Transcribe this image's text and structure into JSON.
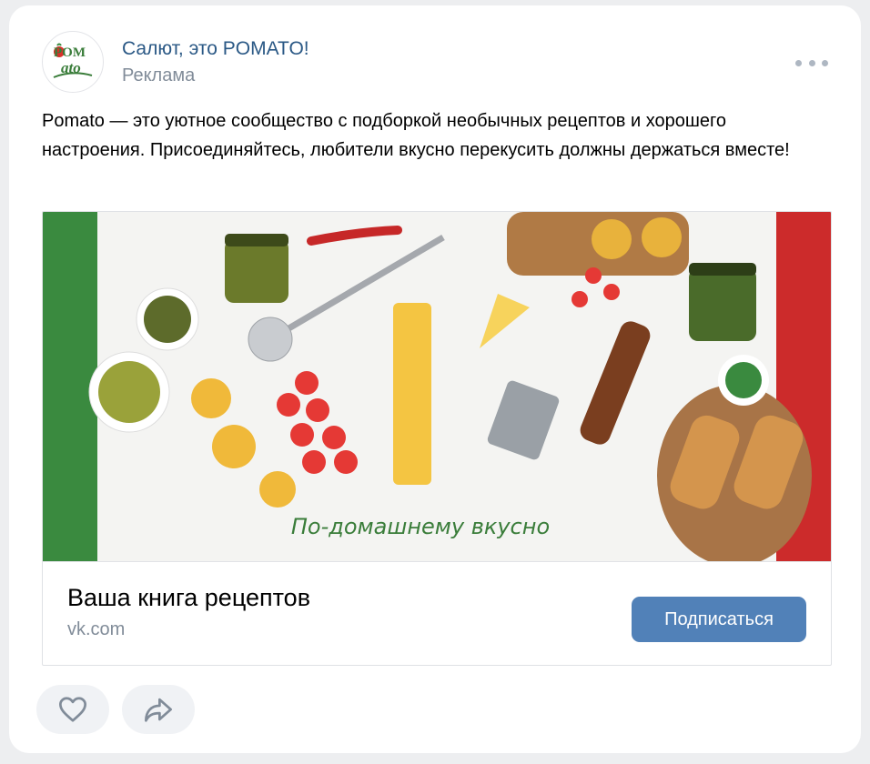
{
  "post": {
    "author": "Салют, это POMATO!",
    "subtitle": "Реклама",
    "text": "Pomato — это уютное сообщество с подборкой необычных рецептов и хорошего настроения. Присоединяйтесь, любители вкусно перекусить должны держаться вместе!"
  },
  "avatar_logo": {
    "line1": "POM",
    "line2": "ato"
  },
  "ad": {
    "image_slogan": "По-домашнему вкусно",
    "title": "Ваша книга рецептов",
    "domain": "vk.com",
    "button_label": "Подписаться"
  },
  "icons": {
    "more": "more-horizontal-icon",
    "like": "heart-icon",
    "share": "share-arrow-icon"
  },
  "colors": {
    "author_link": "#2a5885",
    "secondary_text": "#818c99",
    "button": "#5181b8",
    "flag_green": "#3a8a3f",
    "flag_red": "#cc2b2b"
  }
}
